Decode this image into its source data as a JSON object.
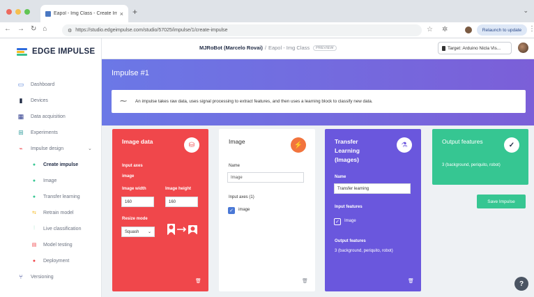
{
  "browser": {
    "tab_title": "Eapol - Img Class - Create Im",
    "tab_close": "×",
    "new_tab": "+",
    "url": "https://studio.edgeimpulse.com/studio/57025/impulse/1/create-impulse",
    "relaunch_label": "Relaunch to update"
  },
  "sidebar": {
    "brand": "EDGE IMPULSE",
    "logo_colors": [
      "#2e6bdc",
      "#f5b91e",
      "#3ac18e"
    ],
    "items": [
      {
        "label": "Dashboard",
        "icon": "monitor-icon",
        "glyph": "▭"
      },
      {
        "label": "Devices",
        "icon": "devices-icon",
        "glyph": "▮"
      },
      {
        "label": "Data acquisition",
        "icon": "database-icon",
        "glyph": "▦"
      },
      {
        "label": "Experiments",
        "icon": "experiments-icon",
        "glyph": "⊞"
      },
      {
        "label": "Impulse design",
        "icon": "impulse-icon",
        "glyph": "⌁"
      },
      {
        "label": "Create impulse",
        "icon": "dot-icon",
        "glyph": "●"
      },
      {
        "label": "Image",
        "icon": "dot-icon",
        "glyph": "●"
      },
      {
        "label": "Transfer learning",
        "icon": "dot-icon",
        "glyph": "●"
      },
      {
        "label": "Retrain model",
        "icon": "retrain-icon",
        "glyph": "⇆"
      },
      {
        "label": "Live classification",
        "icon": "live-icon",
        "glyph": "⫶"
      },
      {
        "label": "Model testing",
        "icon": "testing-icon",
        "glyph": "▤"
      },
      {
        "label": "Deployment",
        "icon": "deploy-icon",
        "glyph": "●"
      },
      {
        "label": "Versioning",
        "icon": "versioning-icon",
        "glyph": "⑂"
      }
    ]
  },
  "header": {
    "owner": "MJRoBot (Marcelo Rovai)",
    "separator": "/",
    "project": "Eapol - Img Class",
    "badge": "PREVIEW",
    "target": "Target: Arduino Nicla Vis..."
  },
  "main": {
    "title": "Impulse #1",
    "info": "An impulse takes raw data, uses signal processing to extract features, and then uses a learning block to classify new data.",
    "save_label": "Save Impulse"
  },
  "cards": {
    "image_data": {
      "title": "Image data",
      "input_axes_label": "Input axes",
      "input_axes_value": "image",
      "width_label": "Image width",
      "width_value": "160",
      "height_label": "Image height",
      "height_value": "160",
      "resize_label": "Resize mode",
      "resize_value": "Squash",
      "color": "#f0474b"
    },
    "image": {
      "title": "Image",
      "name_label": "Name",
      "name_value": "Image",
      "axes_label": "Input axes (1)",
      "axes_item": "image",
      "color": "#f2743d"
    },
    "transfer": {
      "title_1": "Transfer",
      "title_2": "Learning",
      "title_3": "(Images)",
      "name_label": "Name",
      "name_value": "Transfer learning",
      "input_label": "Input features",
      "input_item": "Image",
      "output_label": "Output features",
      "output_value": "3 (background, periquito, robot)",
      "color": "#6a57dd"
    },
    "output": {
      "title": "Output features",
      "value": "3 (background, periquito, robot)",
      "color": "#36c692"
    }
  },
  "help_label": "?"
}
